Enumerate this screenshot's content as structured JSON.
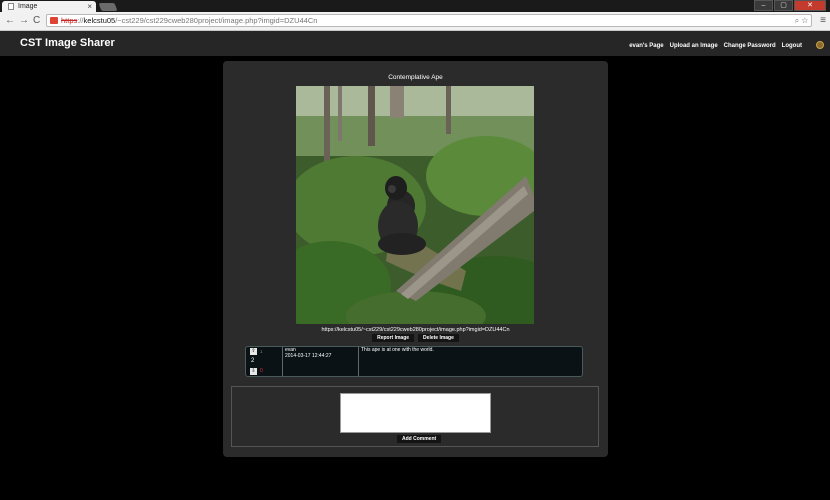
{
  "browser": {
    "tab_title": "Image",
    "tab_close": "×",
    "back": "←",
    "forward": "→",
    "reload": "C",
    "url_scheme": "https",
    "url_sep": "://",
    "url_host": "kelcstu05",
    "url_path": "/~cst229/cst229cweb280project/image.php?imgid=DZU44Cn",
    "omnibox_icons": "⌕ ☆",
    "menu": "≡",
    "window_buttons": [
      "–",
      "▢",
      "✕"
    ]
  },
  "site": {
    "title": "CST Image Sharer",
    "nav": [
      "evan's Page",
      "Upload an Image",
      "Change Password",
      "Logout"
    ]
  },
  "image": {
    "title": "Contemplative Ape",
    "url": "https://kelcstu05/~cst229/cst229cweb280project/image.php?imgid=DZU44Cn",
    "report_label": "Report Image",
    "delete_label": "Delete Image"
  },
  "comments": [
    {
      "up_icon": "⇧",
      "down_icon": "⇩",
      "up_count": "1",
      "score": "2",
      "down_count": "0",
      "author": "evan",
      "date": "2014-03-17 12:44:27",
      "text": "This ape is at one with the world."
    }
  ],
  "new_comment": {
    "value": "",
    "submit_label": "Add Comment"
  }
}
